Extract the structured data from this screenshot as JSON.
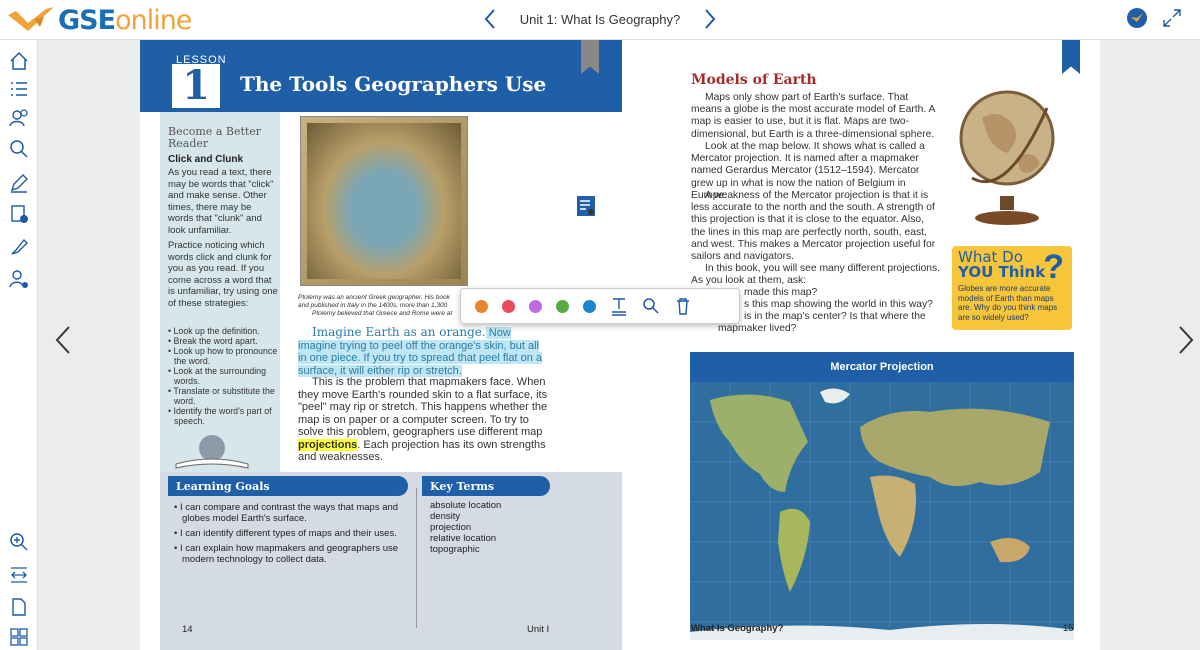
{
  "header": {
    "brand_1": "GSE",
    "brand_2": "online",
    "unit_title": "Unit 1: What Is Geography?"
  },
  "sidebar": {
    "items": [
      "home-icon",
      "list-icon",
      "users-icon",
      "search-icon",
      "edit-icon",
      "add-note-icon",
      "highlighter-icon",
      "user-settings-icon",
      "zoom-in-icon",
      "fit-width-icon",
      "page-icon",
      "grid-icon"
    ]
  },
  "left_page": {
    "lesson_label": "LESSON",
    "lesson_number": "1",
    "lesson_title": "The Tools Geographers Use",
    "panel_head": "Become a Better Reader",
    "panel_sub": "Click and Clunk",
    "panel_p1": "As you read a text, there may be words that \"click\" and make sense. Other times, there may be words that \"clunk\" and look unfamiliar.",
    "panel_p2": "Practice noticing which words click and clunk for you as you read. If you come across a word that is unfamiliar, try using one of these strategies:",
    "panel_list": [
      "Look up the definition.",
      "Break the word apart.",
      "Look up how to pronounce the word.",
      "Look at the surrounding words.",
      "Translate or substitute the word.",
      "Identify the word's part of speech."
    ],
    "caption_1": "Ptolemy was an ancient Greek geographer. His book",
    "caption_2": "and published in Italy in the 1400s, more than 1,300",
    "caption_3": "Ptolemy believed that Greece and Rome were at",
    "para1_lead": "Imagine Earth as an orange.",
    "para1_rest": " Now imagine trying to peel off the orange's skin, but all in one piece. If you try to spread that peel flat on a surface, it will either rip or stretch.",
    "para2_a": "This is the problem that mapmakers face. When they move Earth's rounded skin to a flat surface, its \"peel\" may rip or stretch. This happens whether the map is on paper or a computer screen. To try to solve this problem, geographers use different map",
    "para2_term": "projections",
    "para2_b": ". Each projection has its own strengths and weaknesses.",
    "goals_title": "Learning Goals",
    "goals": [
      "I can compare and contrast the ways that maps and globes model Earth's surface.",
      "I can identify different types of maps and their uses.",
      "I can explain how mapmakers and geographers use modern technology to collect data."
    ],
    "terms_title": "Key Terms",
    "terms": [
      "absolute location",
      "density",
      "projection",
      "relative location",
      "topographic"
    ],
    "page_num": "14",
    "footer": "Unit I"
  },
  "right_page": {
    "title": "Models of Earth",
    "p1": "Maps only show part of Earth's surface. That means a globe is the most accurate model of Earth. A map is easier to use, but it is flat. Maps are two-dimensional, but Earth is a three-dimensional sphere.",
    "p2": "Look at the map below. It shows what is called a Mercator projection. It is named after a mapmaker named Gerardus Mercator (1512–1594). Mercator grew up in what is now the nation of Belgium in Europe.",
    "p3": "A weakness of the Mercator projection is that it is less accurate to the north and the south. A strength of this projection is that it is close to the equator. Also, the lines in this map are perfectly north, south, east, and west. This makes a Mercator projection useful for sailors and navigators.",
    "p4": "In this book, you will see many different projections. As you look at them, ask:",
    "q1": "made this map?",
    "q2": "s this map showing the world in this way?",
    "q3": "is in the map's center? Is that where the",
    "q4": "mapmaker lived?",
    "wdyt_1": "What Do",
    "wdyt_2": "YOU Think",
    "wdyt_body": "Globes are more accurate models of Earth than maps are. Why do you think maps are so widely used?",
    "map_title": "Mercator Projection",
    "footer": "What Is Geography?",
    "page_num": "15"
  },
  "toolbar": {
    "colors": [
      "#e8852e",
      "#e94b5b",
      "#c06ae0",
      "#5aa845",
      "#1b87d0"
    ]
  },
  "colors": {
    "brand_blue": "#1f5fa8",
    "brand_orange": "#f0a33a",
    "panel": "#d7e6ea"
  }
}
